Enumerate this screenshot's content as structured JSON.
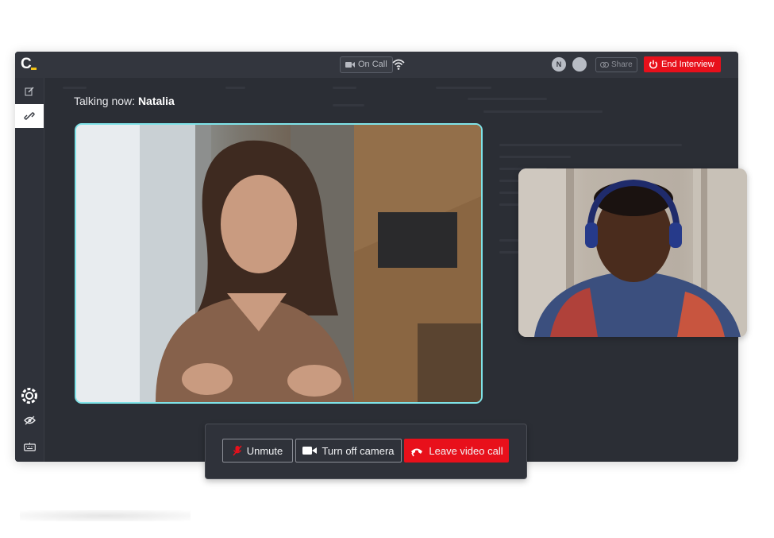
{
  "app": {
    "logo_text": "C"
  },
  "topbar": {
    "call_status": "On Call",
    "avatar_initial": "N",
    "share_label": "Share",
    "end_label": "End Interview"
  },
  "call": {
    "talking_prefix": "Talking now:",
    "talking_name": "Natalia"
  },
  "controls": {
    "unmute_label": "Unmute",
    "camera_label": "Turn off camera",
    "leave_label": "Leave video call"
  },
  "colors": {
    "accent_red": "#e8101b",
    "speaker_border": "#7fe3e8",
    "logo_dash": "#f5c518"
  },
  "icons": [
    "edit-icon",
    "link-icon",
    "settings-icon",
    "eye-icon",
    "keyboard-icon",
    "camera-icon",
    "wifi-icon",
    "power-icon",
    "mic-off-icon",
    "phone-hangup-icon"
  ]
}
